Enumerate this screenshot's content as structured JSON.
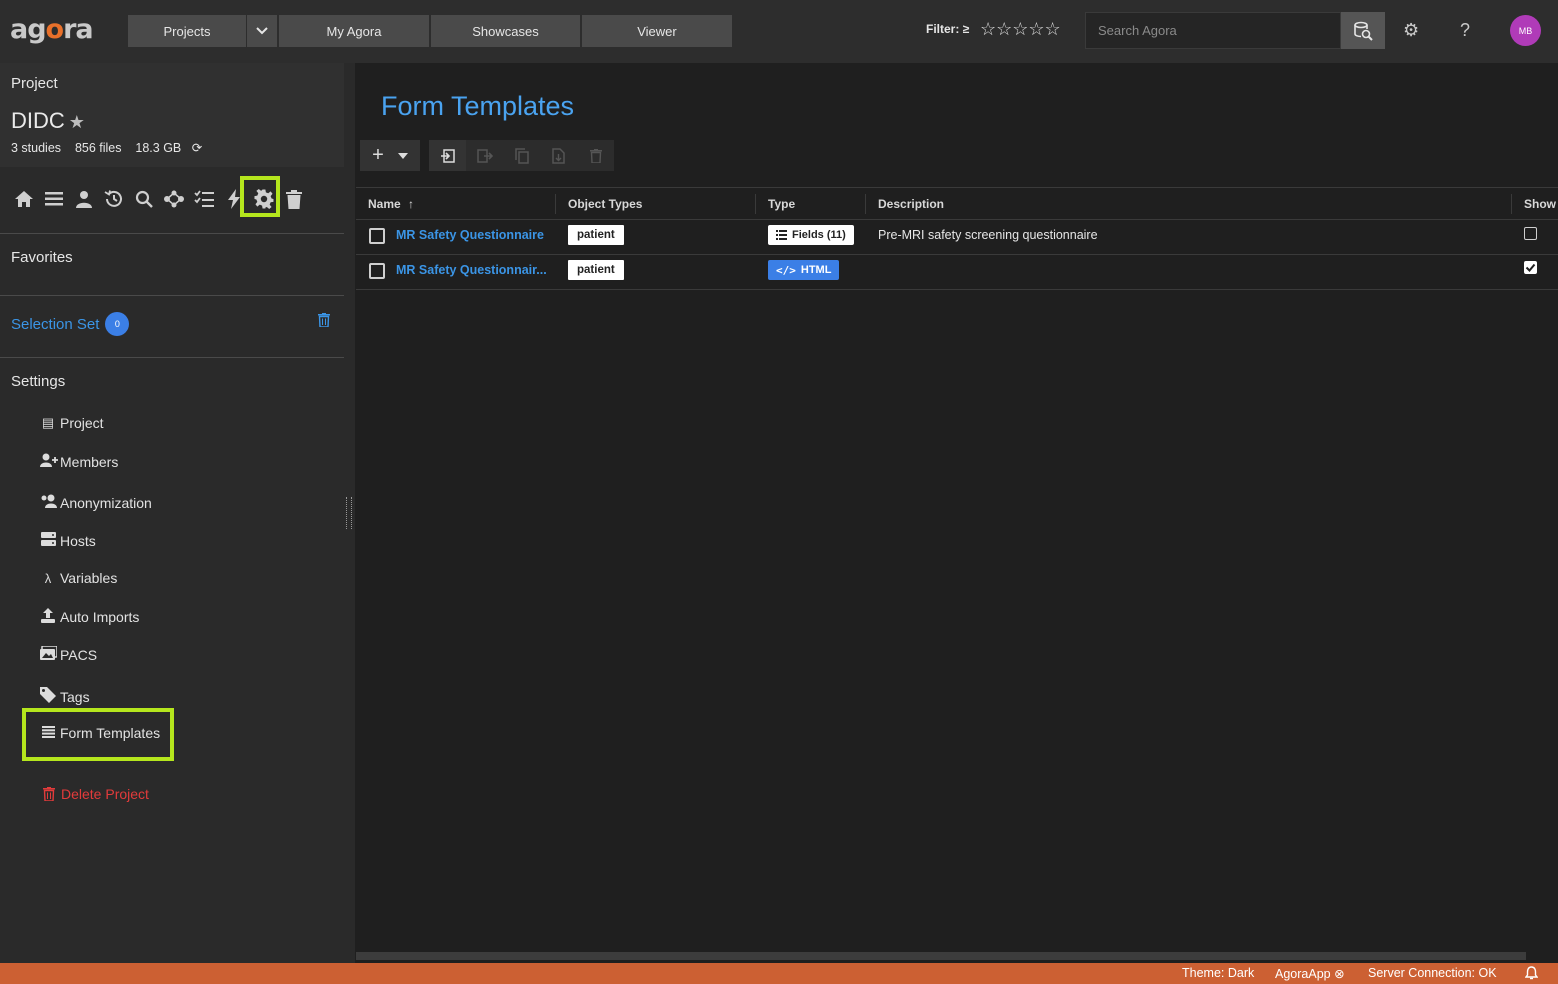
{
  "topbar": {
    "logo_left": "ag",
    "logo_mid": "o",
    "logo_right": "ra",
    "nav": [
      "Projects",
      "My Agora",
      "Showcases",
      "Viewer"
    ],
    "filter_label": "Filter: ≥",
    "stars": "☆☆☆☆☆",
    "search_placeholder": "Search Agora",
    "avatar_initials": "MB"
  },
  "sidebar": {
    "project_label": "Project",
    "project_name": "DIDC",
    "stats": {
      "studies": "3 studies",
      "files": "856 files",
      "size": "18.3 GB"
    },
    "favorites_label": "Favorites",
    "selection_set_label": "Selection Set",
    "selection_count": "0",
    "settings_label": "Settings",
    "settings_items": [
      {
        "label": "Project",
        "icon": "project-icon"
      },
      {
        "label": "Members",
        "icon": "add-user-icon"
      },
      {
        "label": "Anonymization",
        "icon": "anonymize-icon"
      },
      {
        "label": "Hosts",
        "icon": "server-icon"
      },
      {
        "label": "Variables",
        "icon": "lambda-icon"
      },
      {
        "label": "Auto Imports",
        "icon": "upload-icon"
      },
      {
        "label": "PACS",
        "icon": "images-icon"
      },
      {
        "label": "Tags",
        "icon": "tag-icon"
      },
      {
        "label": "Form Templates",
        "icon": "list-icon"
      }
    ],
    "delete_label": "Delete Project"
  },
  "main": {
    "title": "Form Templates",
    "columns": {
      "name": "Name",
      "object_types": "Object Types",
      "type": "Type",
      "description": "Description",
      "show": "Show"
    },
    "rows": [
      {
        "name": "MR Safety Questionnaire",
        "object_type": "patient",
        "type": "Fields (11)",
        "description": "Pre-MRI safety screening questionnaire",
        "show": false
      },
      {
        "name": "MR Safety Questionnair...",
        "object_type": "patient",
        "type": "HTML",
        "description": "",
        "show": true
      }
    ]
  },
  "statusbar": {
    "theme": "Theme: Dark",
    "app": "AgoraApp",
    "connection": "Server Connection: OK"
  },
  "colors": {
    "accent": "#4aa3f0",
    "highlight": "#b5e61d",
    "status": "#cc6033",
    "danger": "#e23b3b"
  }
}
